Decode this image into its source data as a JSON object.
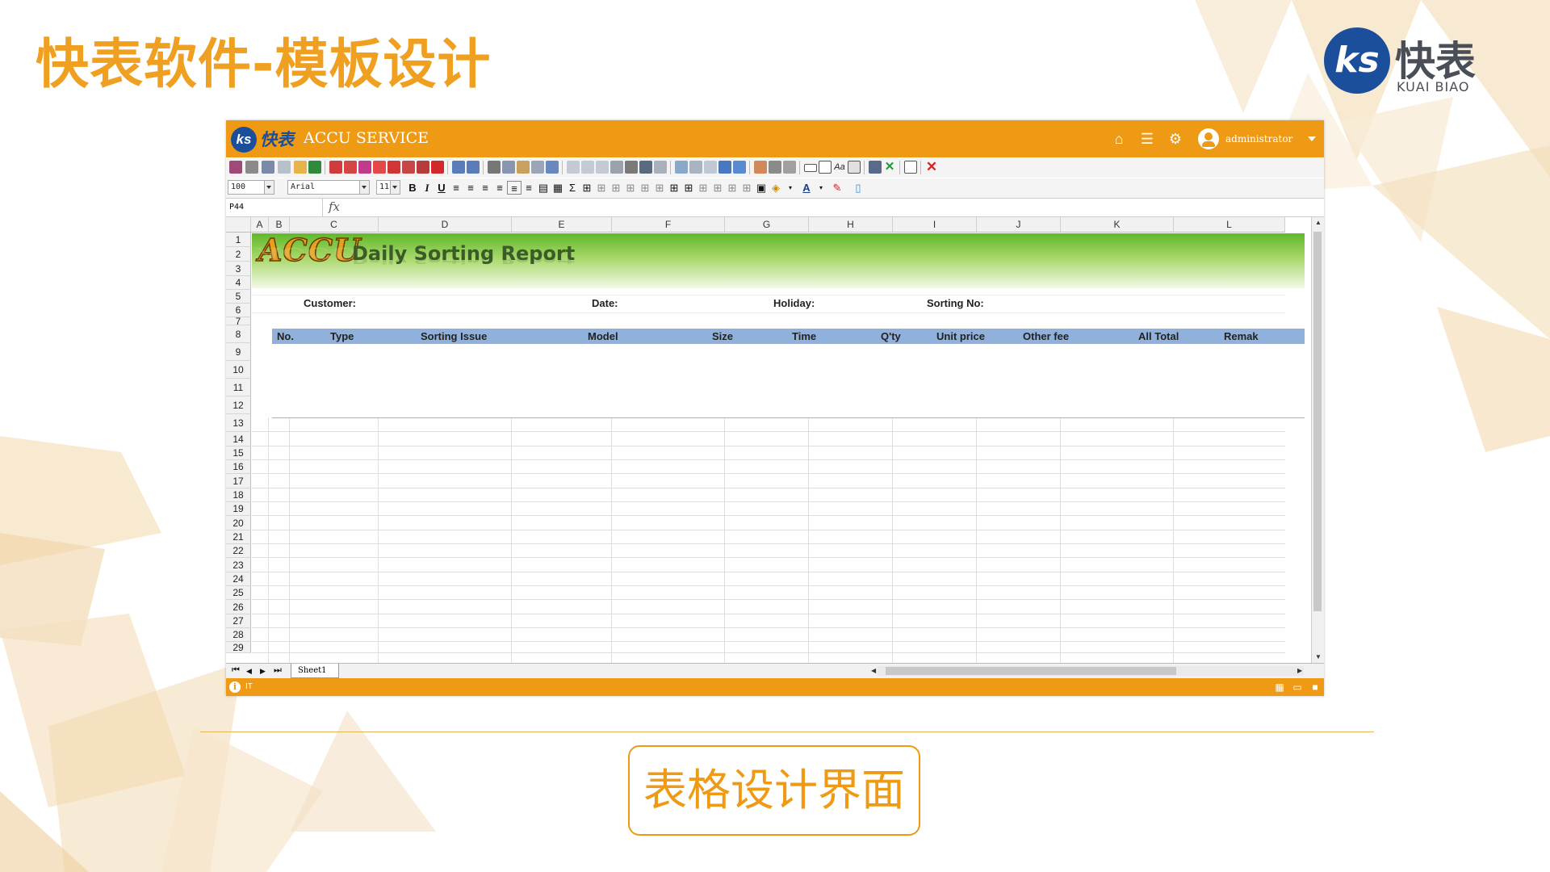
{
  "slide": {
    "title": "快表软件-模板设计",
    "caption": "表格设计界面",
    "brand": {
      "mark": "ks",
      "name_cn": "快表",
      "name_en": "KUAI BIAO"
    },
    "accent_color": "#ef9a14"
  },
  "app": {
    "logo_text": "快表",
    "title": "ACCU SERVICE",
    "header_icons": [
      "home-icon",
      "list-icon",
      "gear-icon"
    ],
    "user": "administrator",
    "header_color": "#ef9a14"
  },
  "toolbar": {
    "zoom": "100",
    "font": "Arial",
    "font_size": "11",
    "bold": "B",
    "italic": "I",
    "underline": "U",
    "sum": "Σ"
  },
  "formula_bar": {
    "cell_ref": "P44",
    "fx": "fx"
  },
  "sheet": {
    "columns": [
      "A",
      "B",
      "C",
      "D",
      "E",
      "F",
      "G",
      "H",
      "I",
      "J",
      "K",
      "L"
    ],
    "rows": [
      "1",
      "2",
      "3",
      "4",
      "5",
      "6",
      "7",
      "8",
      "9",
      "10",
      "11",
      "12",
      "13",
      "14",
      "15",
      "16",
      "17",
      "18",
      "19",
      "20",
      "21",
      "22",
      "23",
      "24",
      "25",
      "26",
      "27",
      "28",
      "29"
    ],
    "banner": {
      "logo": "ACCU",
      "title": "Daily Sorting Report"
    },
    "fields": {
      "customer": "Customer:",
      "date": "Date:",
      "holiday": "Holiday:",
      "sorting_no": "Sorting No:"
    },
    "table_headers": [
      "No.",
      "Type",
      "Sorting Issue",
      "Model",
      "Size",
      "Time",
      "Q'ty",
      "Unit price",
      "Other fee",
      "All Total",
      "Remak"
    ],
    "header_fill": "#8fb1dc",
    "tab": "Sheet1"
  },
  "status_bar": {
    "text": "IT"
  }
}
